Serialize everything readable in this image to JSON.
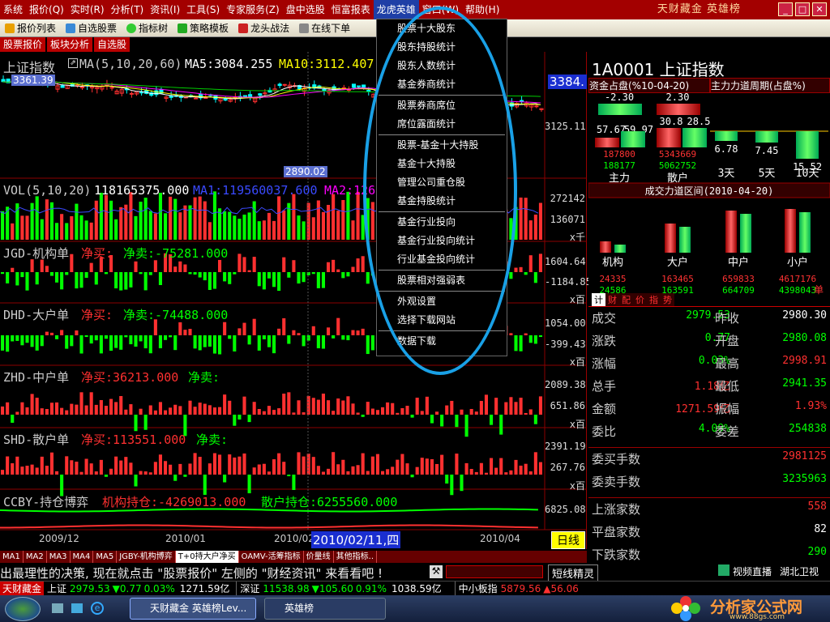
{
  "menubar": {
    "items": [
      "系统",
      "报价(Q)",
      "实时(R)",
      "分析(T)",
      "资讯(I)",
      "工具(S)",
      "专家服务(Z)",
      "盘中选股",
      "恒富报表",
      "龙虎英雄",
      "窗口(W)",
      "帮助(H)"
    ],
    "brand": "天财藏金  英雄榜",
    "win_buttons": [
      "_",
      "□",
      "✕"
    ]
  },
  "toolbar": {
    "items": [
      "报价列表",
      "自选股票",
      "指标树",
      "策略模板",
      "龙头战法",
      "在线下单"
    ]
  },
  "tabs": [
    "股票报价",
    "板块分析",
    "自选股"
  ],
  "dropdown": {
    "groups": [
      [
        "股票十大股东",
        "股东持股统计",
        "股东人数统计",
        "基金券商统计"
      ],
      [
        "股票券商席位",
        "席位露面统计"
      ],
      [
        "股票-基金十大持股",
        "基金十大持股",
        "管理公司重仓股",
        "基金持股统计"
      ],
      [
        "基金行业投向",
        "基金行业投向统计",
        "行业基金投向统计"
      ],
      [
        "股票相对强弱表"
      ],
      [
        "外观设置",
        "选择下载网站"
      ],
      [
        "数据下载"
      ]
    ]
  },
  "chart": {
    "main_label": "上证指数",
    "ma_label": "MA(5,10,20,60)",
    "ma5": "MA5:3084.255",
    "ma10": "MA10:3112.407",
    "high_tag": "3361.39",
    "low_tag": "2890.02",
    "price_tag": "3384.",
    "main_scale": "3125.11",
    "vol_label": "VOL(5,10,20)",
    "vol_value": "118165375.000",
    "vol_ma1": "MA1:119560037.600",
    "vol_ma2": "MA2:126",
    "vol_scale_1": "272142",
    "vol_scale_2": "136071",
    "vol_unit": "x千",
    "jgd_label": "JGD-机构单",
    "jgd_buy": "净买:",
    "jgd_sell": "净卖:-75281.000",
    "jgd_scale_1": "1604.64",
    "jgd_scale_2": "-1184.85",
    "dhd_label": "DHD-大户单",
    "dhd_buy": "净买:",
    "dhd_sell": "净卖:-74488.000",
    "dhd_scale_1": "1054.00",
    "dhd_scale_2": "-399.43",
    "zhd_label": "ZHD-中户单",
    "zhd_buy": "净买:36213.000",
    "zhd_sell": "净卖:",
    "zhd_scale_1": "2089.38",
    "zhd_scale_2": "651.86",
    "shd_label": "SHD-散户单",
    "shd_buy": "净买:113551.000",
    "shd_sell": "净卖:",
    "shd_scale_1": "2391.19",
    "shd_scale_2": "267.76",
    "unit_hundred": "x百",
    "ccby_label": "CCBY-持仓博弈",
    "ccby_inst": "机构持仓:-4269013.000",
    "ccby_retail": "散户持仓:6255560.000",
    "ccby_scale": "6825.08",
    "dates": [
      "2009/12",
      "2010/01",
      "2010/02",
      "2010/04"
    ],
    "cursor_date": "2010/02/11,四",
    "period_button": "日线"
  },
  "rightpanel": {
    "title": "1A0001 上证指数",
    "fund_title": "资金占盘(%10-04-20)",
    "cycle_title": "主力力道周期(占盘%)",
    "main_force": "主力",
    "retail": "散户",
    "fund_vals": [
      "-2.30",
      "2.30",
      "57.67",
      "59.97",
      "30.8",
      "28.5"
    ],
    "fund_nums": [
      "187800",
      "5343669",
      "188177",
      "5062752"
    ],
    "cycle_vals": [
      "6.78",
      "7.45",
      "15.52"
    ],
    "cycle_labels": [
      "3天",
      "5天",
      "10天"
    ],
    "zone_title": "成交力道区间(2010-04-20)",
    "zone_labels": [
      "机构",
      "大户",
      "中户",
      "小户"
    ],
    "zone_red": [
      "24335",
      "163465",
      "659833",
      "4617176"
    ],
    "zone_green": [
      "24586",
      "163591",
      "664709",
      "4398043"
    ],
    "zone_unit": "单",
    "mini_tabs": [
      "计",
      "财",
      "配",
      "价",
      "指",
      "势"
    ],
    "quote": [
      {
        "l": "成交",
        "v": "2979.53",
        "l2": "昨收",
        "v2": "2980.30"
      },
      {
        "l": "涨跌",
        "v": "0.77",
        "l2": "开盘",
        "v2": "2980.08"
      },
      {
        "l": "涨幅",
        "v": "0.03%",
        "l2": "最高",
        "v2": "2998.91"
      },
      {
        "l": "总手",
        "v": "1.18亿",
        "l2": "最低",
        "v2": "2941.35"
      },
      {
        "l": "金额",
        "v": "1271.59亿",
        "l2": "振幅",
        "v2": "1.93%"
      },
      {
        "l": "委比",
        "v": "4.09%",
        "l2": "委差",
        "v2": "254838"
      }
    ],
    "quote2": [
      {
        "l": "委买手数",
        "v": "2981125"
      },
      {
        "l": "委卖手数",
        "v": "3235963"
      }
    ],
    "quote3": [
      {
        "l": "上涨家数",
        "v": "558"
      },
      {
        "l": "平盘家数",
        "v": "82"
      },
      {
        "l": "下跌家数",
        "v": "290"
      }
    ]
  },
  "indicator_tabs": [
    "MA1",
    "MA2",
    "MA3",
    "MA4",
    "MA5",
    "JGBY-机构博弈",
    "T+0持大户净买",
    "OAMV-活筹指标",
    "价量线",
    "其他指标.."
  ],
  "news": {
    "text": "出最理性的决策, 现在就点击 \"股票报价\" 左侧的 \"财经资讯\" 来看看吧 !",
    "short_elf": "短线精灵",
    "video": "视频直播",
    "channel": "湖北卫视"
  },
  "ticker": {
    "brand": "天财藏金",
    "sh_label": "上证",
    "sh_value": "2979.53",
    "sh_change": "▼0.77",
    "sh_pct": "0.03%",
    "sh_amount": "1271.59亿",
    "sz_label": "深证",
    "sz_value": "11538.98",
    "sz_change": "▼105.60",
    "sz_pct": "0.91%",
    "sz_amount": "1038.59亿",
    "sme_label": "中小板指",
    "sme_value": "5879.56",
    "sme_change": "▲56.06"
  },
  "taskbar": {
    "items": [
      "天财藏金 英雄榜Lev...",
      "英雄榜"
    ]
  },
  "watermark": {
    "text": "分析家公式网",
    "url": "www.88gs.com"
  },
  "colors": {
    "up": "#ff3030",
    "down": "#00ff00",
    "title_bar": "#a30000",
    "accent_blue": "#19a0e6"
  }
}
